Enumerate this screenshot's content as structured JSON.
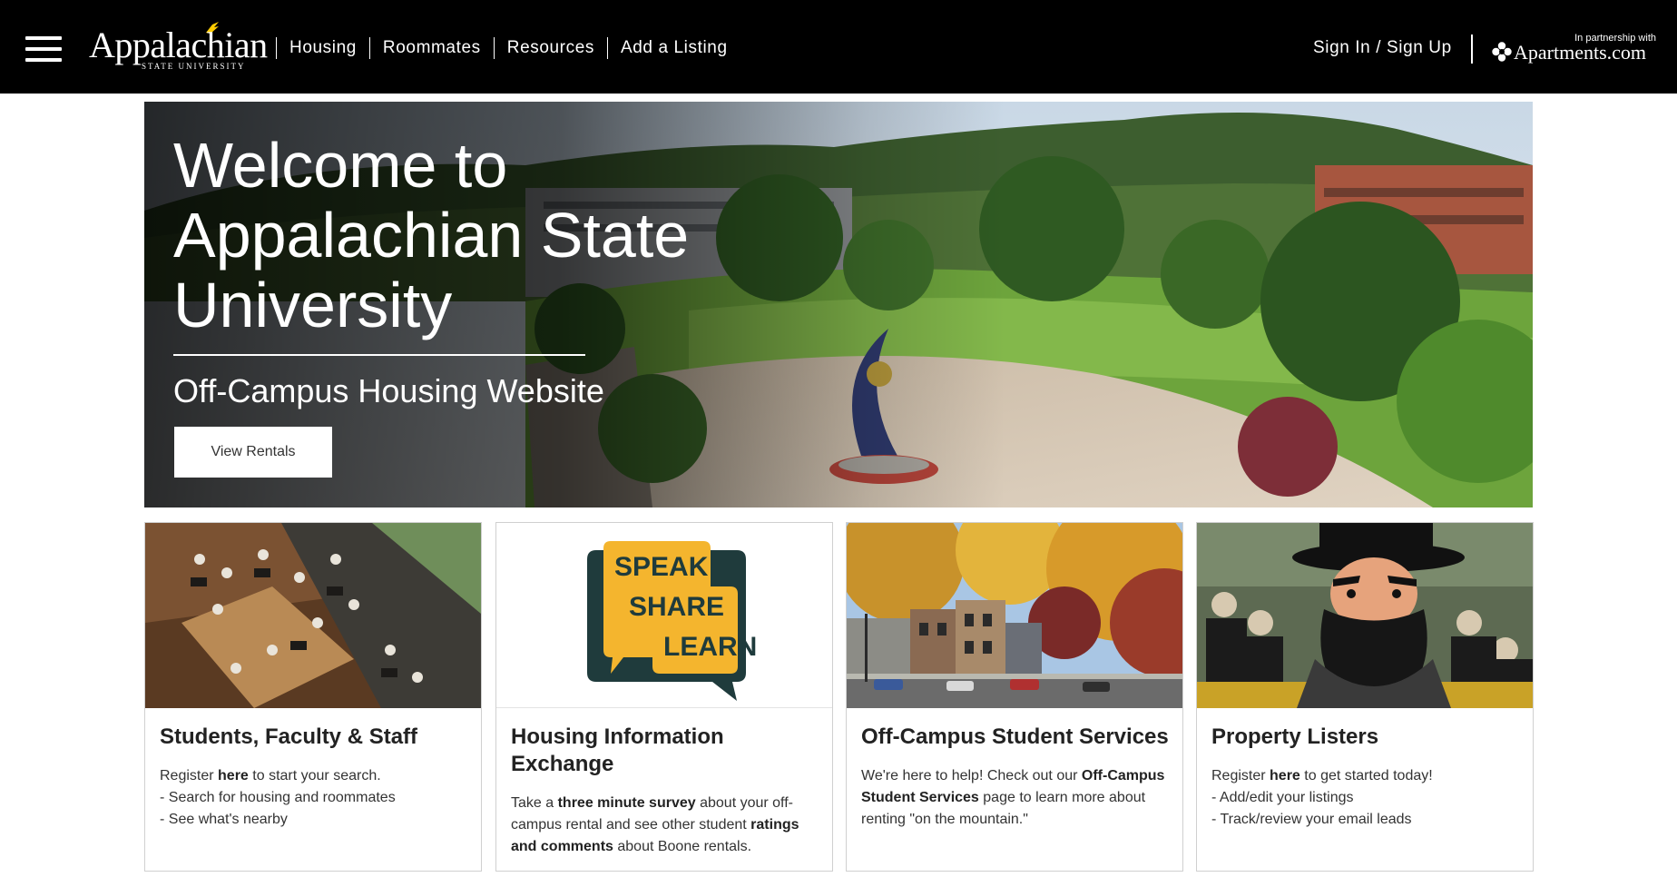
{
  "header": {
    "logo": {
      "name": "Appalachian",
      "sub": "STATE UNIVERSITY"
    },
    "nav": [
      {
        "label": "Housing"
      },
      {
        "label": "Roommates"
      },
      {
        "label": "Resources"
      },
      {
        "label": "Add a Listing"
      }
    ],
    "signin_label": "Sign In / Sign Up",
    "partner": {
      "label": "In partnership with",
      "brand": "Apartments.com"
    },
    "menu_icon": "hamburger-icon"
  },
  "hero": {
    "title": "Welcome to Appalachian State University",
    "subtitle": "Off-Campus Housing Website",
    "button_label": "View Rentals"
  },
  "cards": [
    {
      "title": "Students, Faculty & Staff",
      "pre": "Register ",
      "bold": "here",
      "post": " to start your search.",
      "line2": "- Search for housing and roommates",
      "line3": "- See what's nearby"
    },
    {
      "title": "Housing Information Exchange",
      "logo": {
        "speak": "SPEAK",
        "share": "SHARE",
        "learn": "LEARN"
      },
      "t1": "Take a ",
      "b1": "three minute survey",
      "t2": " about your off-campus rental and see other student ",
      "b2": "ratings and comments",
      "t3": " about Boone rentals."
    },
    {
      "title": "Off-Campus Student Services",
      "t1": "We're here to help! Check out our ",
      "b1": "Off-Campus Student Services",
      "t2": " page to learn more about renting \"on the mountain.\""
    },
    {
      "title": "Property Listers",
      "pre": "Register ",
      "bold": "here",
      "post": " to get started today!",
      "line2": "- Add/edit your listings",
      "line3": "- Track/review your email leads"
    }
  ],
  "colors": {
    "header_bg": "#000000",
    "app_gold": "#ffcc00",
    "app_black": "#222222",
    "speak_teal": "#1f3b3c"
  }
}
